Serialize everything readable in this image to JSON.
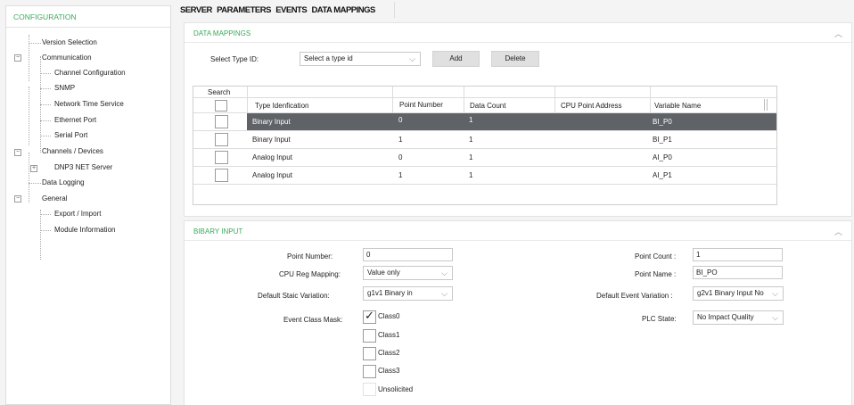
{
  "sidebar": {
    "header": "CONFIGURATION",
    "items": [
      {
        "label": "Version Selection"
      },
      {
        "label": "Communication"
      },
      {
        "label": "Channel Configuration"
      },
      {
        "label": "SNMP"
      },
      {
        "label": "Network Time Service"
      },
      {
        "label": "Ethernet Port"
      },
      {
        "label": "Serial Port"
      },
      {
        "label": "Channels / Devices"
      },
      {
        "label": "DNP3 NET Server"
      },
      {
        "label": "Data Logging"
      },
      {
        "label": "General"
      },
      {
        "label": "Export / Import"
      },
      {
        "label": "Module Information"
      }
    ]
  },
  "tabs": [
    "SERVER",
    "PARAMETERS",
    "EVENTS",
    "DATA MAPPINGS"
  ],
  "data_mappings": {
    "title": "DATA MAPPINGS",
    "select_type_label": "Select Type ID:",
    "select_type_value": "Select a type id",
    "add_label": "Add",
    "delete_label": "Delete",
    "search_label": "Search",
    "columns": [
      "Type Idenfication",
      "Point Number",
      "Data Count",
      "CPU Point Address",
      "Variable Name"
    ],
    "rows": [
      {
        "type": "Binary Input",
        "point": "0",
        "count": "1",
        "cpu": "",
        "var": "BI_P0"
      },
      {
        "type": "Binary Input",
        "point": "1",
        "count": "1",
        "cpu": "",
        "var": "BI_P1"
      },
      {
        "type": "Analog Input",
        "point": "0",
        "count": "1",
        "cpu": "",
        "var": "AI_P0"
      },
      {
        "type": "Analog Input",
        "point": "1",
        "count": "1",
        "cpu": "",
        "var": "AI_P1"
      }
    ]
  },
  "binary_input": {
    "title": "BIBARY INPUT",
    "point_number_label": "Point Number:",
    "point_number_value": "0",
    "cpu_reg_label": "CPU Reg Mapping:",
    "cpu_reg_value": "Value only",
    "default_static_label": "Default Staic Variation:",
    "default_static_value": "g1v1 Binary in",
    "event_class_label": "Event Class Mask:",
    "classes": [
      "Class0",
      "Class1",
      "Class2",
      "Class3",
      "Unsolicited"
    ],
    "point_count_label": "Point Count :",
    "point_count_value": "1",
    "point_name_label": "Point Name :",
    "point_name_value": "BI_PO",
    "default_event_label": "Default Event Variation :",
    "default_event_value": "g2v1 Binary Input No",
    "plc_state_label": "PLC State:",
    "plc_state_value": "No Impact Quality"
  },
  "colors": {
    "accent_green": "#3aaa5c",
    "selected_row": "#5f6368"
  }
}
